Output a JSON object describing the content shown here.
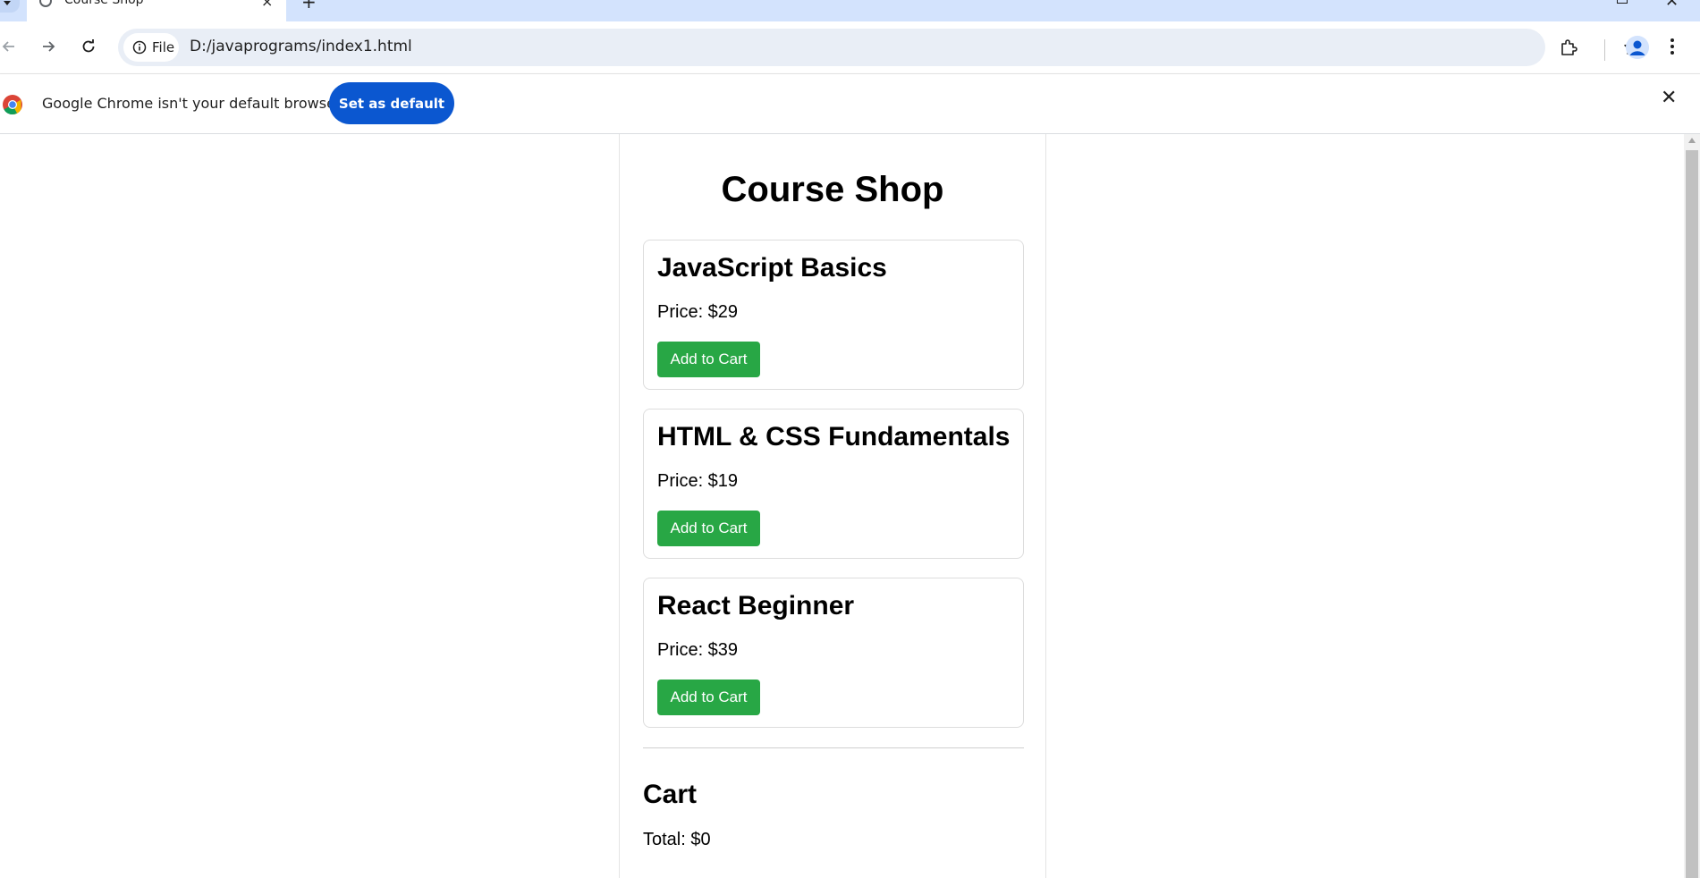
{
  "browser": {
    "tab_title": "Course Shop",
    "tab_close_glyph": "×",
    "new_tab_glyph": "+",
    "window_close_glyph": "✕",
    "chip_label": "File",
    "url": "D:/javaprograms/index1.html"
  },
  "infobar": {
    "message": "Google Chrome isn't your default browser",
    "button_label": "Set as default",
    "close_glyph": "✕"
  },
  "page": {
    "title": "Course Shop",
    "courses": [
      {
        "name": "JavaScript Basics",
        "price": "Price: $29",
        "button": "Add to Cart"
      },
      {
        "name": "HTML & CSS Fundamentals",
        "price": "Price: $19",
        "button": "Add to Cart"
      },
      {
        "name": "React Beginner",
        "price": "Price: $39",
        "button": "Add to Cart"
      }
    ],
    "cart": {
      "title": "Cart",
      "total": "Total: $0"
    }
  },
  "colors": {
    "accent": "#0b57d0",
    "button_green": "#28a745",
    "tabstrip": "#d3e3fd"
  }
}
